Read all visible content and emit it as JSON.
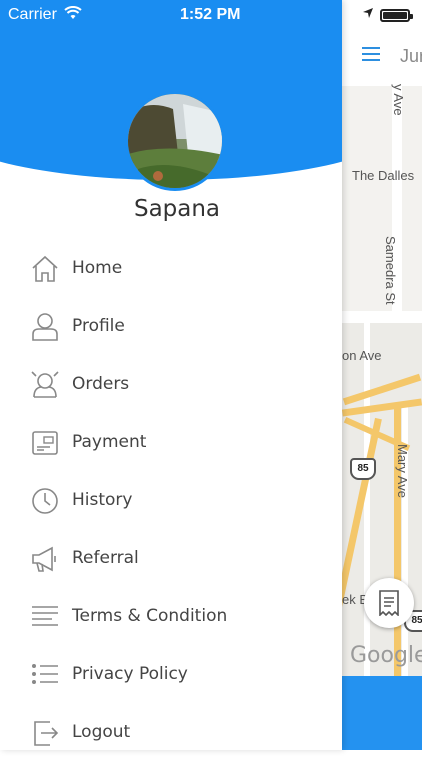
{
  "status_bar": {
    "carrier": "Carrier",
    "time": "1:52 PM"
  },
  "drawer": {
    "user_name": "Sapana",
    "accent_color": "#1a8df1",
    "menu": [
      {
        "label": "Home",
        "icon": "home-icon"
      },
      {
        "label": "Profile",
        "icon": "profile-icon"
      },
      {
        "label": "Orders",
        "icon": "orders-icon"
      },
      {
        "label": "Payment",
        "icon": "payment-icon"
      },
      {
        "label": "History",
        "icon": "clock-icon"
      },
      {
        "label": "Referral",
        "icon": "megaphone-icon"
      },
      {
        "label": "Terms & Condition",
        "icon": "lines-icon"
      },
      {
        "label": "Privacy Policy",
        "icon": "list-icon"
      },
      {
        "label": "Logout",
        "icon": "logout-icon"
      }
    ]
  },
  "map_panel": {
    "title": "Jur",
    "labels": {
      "street_top": "y Ave",
      "the_dalles": "The Dalles",
      "samedra": "Samedra St",
      "on_ave": "on Ave",
      "mary_ave": "Mary Ave",
      "ek_b": "ek B",
      "highway_1": "85",
      "highway_2": "85"
    },
    "attribution": "Google"
  }
}
